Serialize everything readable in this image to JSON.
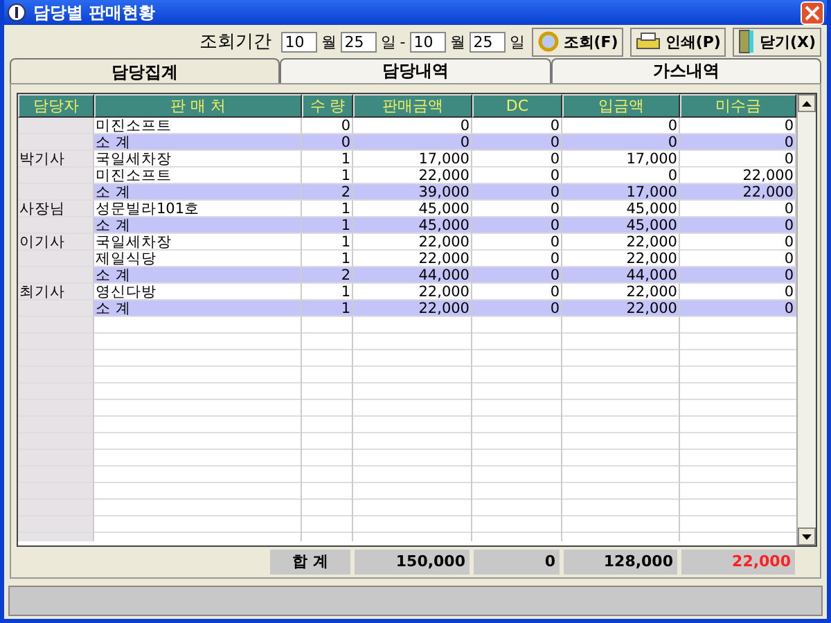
{
  "window": {
    "title": "담당별 판매현황"
  },
  "query": {
    "label": "조회기간",
    "from_month": "10",
    "month_unit_1": "월",
    "from_day": "25",
    "day_unit_1": "일",
    "separator": "-",
    "to_month": "10",
    "month_unit_2": "월",
    "to_day": "25",
    "day_unit_2": "일"
  },
  "buttons": [
    {
      "kind": "search",
      "label": "조회(F)"
    },
    {
      "kind": "print",
      "label": "인쇄(P)"
    },
    {
      "kind": "close",
      "label": "닫기(X)"
    }
  ],
  "tabs": [
    {
      "label": "담당집계",
      "selected": true
    },
    {
      "label": "담당내역",
      "selected": false
    },
    {
      "label": "가스내역",
      "selected": false
    }
  ],
  "table": {
    "columns": [
      "담당자",
      "판 매 처",
      "수 량",
      "판매금액",
      "DC",
      "입금액",
      "미수금"
    ],
    "rows": [
      {
        "kind": "item",
        "cells": [
          "",
          "미진소프트",
          "0",
          "0",
          "0",
          "0",
          "0"
        ]
      },
      {
        "kind": "subtotal",
        "cells": [
          "",
          "소 계",
          "0",
          "0",
          "0",
          "0",
          "0"
        ]
      },
      {
        "kind": "item",
        "cells": [
          "박기사",
          "국일세차장",
          "1",
          "17,000",
          "0",
          "17,000",
          "0"
        ]
      },
      {
        "kind": "item",
        "cells": [
          "",
          "미진소프트",
          "1",
          "22,000",
          "0",
          "0",
          "22,000"
        ]
      },
      {
        "kind": "subtotal",
        "cells": [
          "",
          "소 계",
          "2",
          "39,000",
          "0",
          "17,000",
          "22,000"
        ]
      },
      {
        "kind": "item",
        "cells": [
          "사장님",
          "성문빌라101호",
          "1",
          "45,000",
          "0",
          "45,000",
          "0"
        ]
      },
      {
        "kind": "subtotal",
        "cells": [
          "",
          "소 계",
          "1",
          "45,000",
          "0",
          "45,000",
          "0"
        ]
      },
      {
        "kind": "item",
        "cells": [
          "이기사",
          "국일세차장",
          "1",
          "22,000",
          "0",
          "22,000",
          "0"
        ]
      },
      {
        "kind": "item",
        "cells": [
          "",
          "제일식당",
          "1",
          "22,000",
          "0",
          "22,000",
          "0"
        ]
      },
      {
        "kind": "subtotal",
        "cells": [
          "",
          "소 계",
          "2",
          "44,000",
          "0",
          "44,000",
          "0"
        ]
      },
      {
        "kind": "item",
        "cells": [
          "최기사",
          "영신다방",
          "1",
          "22,000",
          "0",
          "22,000",
          "0"
        ]
      },
      {
        "kind": "subtotal",
        "cells": [
          "",
          "소 계",
          "1",
          "22,000",
          "0",
          "22,000",
          "0"
        ]
      }
    ]
  },
  "totals": {
    "label": "합 계",
    "values": [
      "150,000",
      "0",
      "128,000",
      "22,000"
    ]
  }
}
